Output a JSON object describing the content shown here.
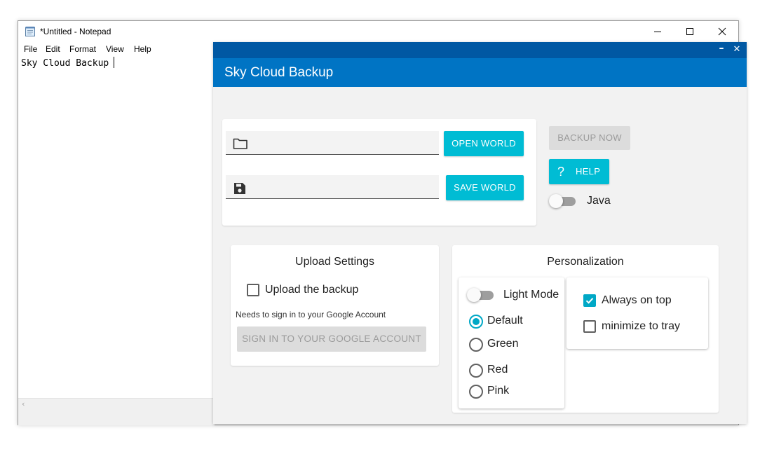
{
  "notepad": {
    "title": "*Untitled - Notepad",
    "menu": [
      "File",
      "Edit",
      "Format",
      "View",
      "Help"
    ],
    "content": "Sky Cloud Backup"
  },
  "app": {
    "title": "Sky Cloud Backup",
    "open_world_label": "OPEN WORLD",
    "save_world_label": "SAVE WORLD",
    "open_world_value": "",
    "save_world_value": "",
    "backup_now_label": "BACKUP NOW",
    "help_label": "HELP",
    "java_label": "Java",
    "java_enabled": false,
    "upload": {
      "heading": "Upload Settings",
      "upload_checkbox_label": "Upload the backup",
      "upload_checked": false,
      "sign_in_note": "Needs to sign in to your Google Account",
      "sign_in_button": "SIGN IN TO YOUR GOOGLE ACCOUNT"
    },
    "personalization": {
      "heading": "Personalization",
      "light_mode_label": "Light Mode",
      "light_mode_enabled": false,
      "themes": [
        "Default",
        "Green",
        "Red",
        "Pink"
      ],
      "selected_theme": "Default",
      "always_on_top_label": "Always on top",
      "always_on_top_checked": true,
      "minimize_to_tray_label": "minimize to tray",
      "minimize_to_tray_checked": false
    }
  },
  "colors": {
    "app_header": "#0074c4",
    "app_topbar": "#0058a3",
    "accent": "#00bcd4",
    "check_accent": "#00a8c6"
  }
}
